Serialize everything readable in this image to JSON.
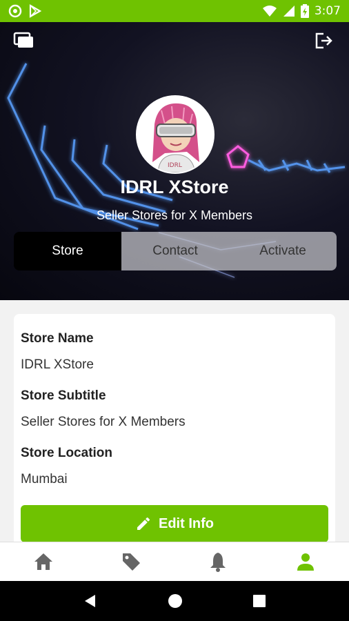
{
  "status_bar": {
    "time": "3:07",
    "icons": [
      "circle-notification-icon",
      "play-store-icon",
      "wifi-icon",
      "signal-icon",
      "battery-icon"
    ]
  },
  "header": {
    "left_icon": "switch-stores-icon",
    "right_icon": "logout-icon",
    "store_title": "IDRL XStore",
    "store_subtitle": "Seller Stores for X Members"
  },
  "tabs": [
    {
      "label": "Store",
      "active": true
    },
    {
      "label": "Contact",
      "active": false
    },
    {
      "label": "Activate",
      "active": false
    }
  ],
  "store_info": {
    "name_label": "Store Name",
    "name_value": "IDRL XStore",
    "subtitle_label": "Store Subtitle",
    "subtitle_value": "Seller Stores for X Members",
    "location_label": "Store Location",
    "location_value": "Mumbai",
    "edit_button": "Edit Info"
  },
  "bottom_nav": {
    "items": [
      "home-icon",
      "tag-icon",
      "bell-icon",
      "profile-icon"
    ],
    "active": "profile-icon"
  },
  "colors": {
    "accent": "#6fc201",
    "inactive_icon": "#666666"
  }
}
